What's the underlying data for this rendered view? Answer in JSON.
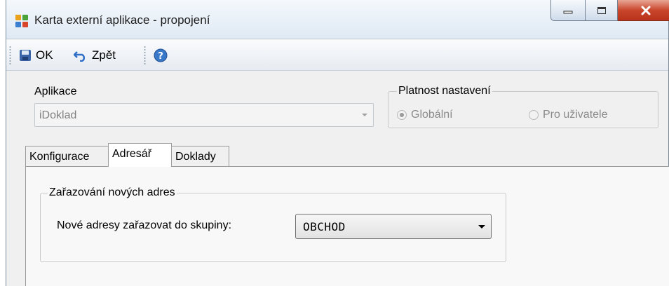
{
  "window": {
    "title": "Karta externí aplikace - propojení"
  },
  "toolbar": {
    "ok_label": "OK",
    "back_label": "Zpět"
  },
  "app": {
    "label": "Aplikace",
    "value": "iDoklad",
    "disabled": true
  },
  "scope": {
    "legend": "Platnost nastavení",
    "options": [
      {
        "label": "Globální",
        "selected": true
      },
      {
        "label": "Pro uživatele",
        "selected": false
      }
    ]
  },
  "tabs": [
    {
      "label": "Konfigurace",
      "active": false
    },
    {
      "label": "Adresář",
      "active": true
    },
    {
      "label": "Doklady",
      "active": false
    }
  ],
  "group": {
    "legend": "Zařazování nových adres",
    "field_label": "Nové adresy zařazovat do skupiny:",
    "group_value": "OBCHOD"
  },
  "colors": {
    "close_button": "#c9462c",
    "window_border": "#7a8a99",
    "panel_bg": "#f0f0f0"
  }
}
